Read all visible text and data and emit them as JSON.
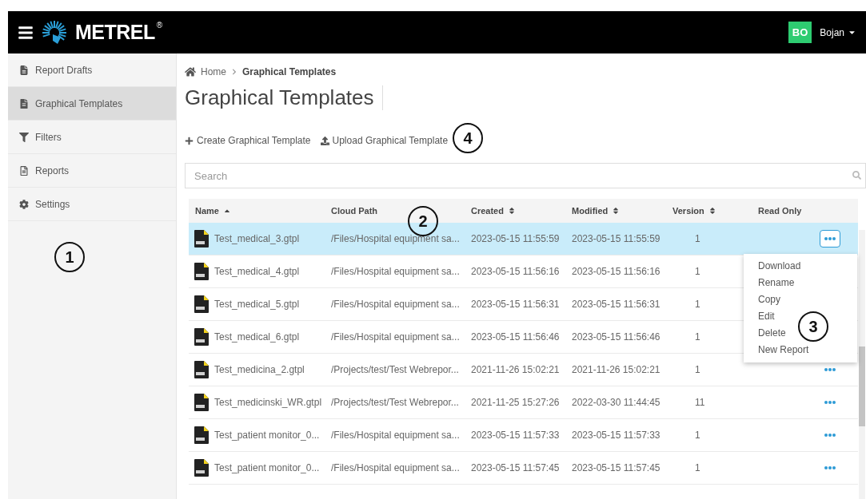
{
  "header": {
    "logo": "METREL",
    "logo_mark": "®",
    "user": {
      "initials": "BO",
      "name": "Bojan"
    }
  },
  "sidebar": {
    "items": [
      {
        "label": "Report Drafts",
        "selected": false
      },
      {
        "label": "Graphical Templates",
        "selected": true
      },
      {
        "label": "Filters",
        "selected": false
      },
      {
        "label": "Reports",
        "selected": false
      },
      {
        "label": "Settings",
        "selected": false
      }
    ]
  },
  "breadcrumb": {
    "home": "Home",
    "current": "Graphical Templates"
  },
  "page_title": "Graphical Templates",
  "actions": [
    {
      "label": "Create Graphical Template"
    },
    {
      "label": "Upload Graphical Template"
    }
  ],
  "search": {
    "placeholder": "Search"
  },
  "table": {
    "columns": [
      {
        "label": "Name",
        "sorted": true,
        "sortable": true
      },
      {
        "label": "Cloud Path",
        "sorted": false,
        "sortable": false
      },
      {
        "label": "Created",
        "sorted": false,
        "sortable": true
      },
      {
        "label": "Modified",
        "sorted": false,
        "sortable": true
      },
      {
        "label": "Version",
        "sorted": false,
        "sortable": true
      },
      {
        "label": "Read Only",
        "sorted": false,
        "sortable": false
      }
    ],
    "rows": [
      {
        "name": "Test_medical_3.gtpl",
        "path": "/Files/Hospital equipment sa...",
        "created": "2023-05-15 11:55:59",
        "modified": "2023-05-15 11:55:59",
        "version": "1",
        "selected": true,
        "actions_shown": true
      },
      {
        "name": "Test_medical_4.gtpl",
        "path": "/Files/Hospital equipment sa...",
        "created": "2023-05-15 11:56:16",
        "modified": "2023-05-15 11:56:16",
        "version": "1",
        "selected": false,
        "actions_shown": false
      },
      {
        "name": "Test_medical_5.gtpl",
        "path": "/Files/Hospital equipment sa...",
        "created": "2023-05-15 11:56:31",
        "modified": "2023-05-15 11:56:31",
        "version": "1",
        "selected": false,
        "actions_shown": false
      },
      {
        "name": "Test_medical_6.gtpl",
        "path": "/Files/Hospital equipment sa...",
        "created": "2023-05-15 11:56:46",
        "modified": "2023-05-15 11:56:46",
        "version": "1",
        "selected": false,
        "actions_shown": false
      },
      {
        "name": "Test_medicina_2.gtpl",
        "path": "/Projects/test/Test Webrepor...",
        "created": "2021-11-26 15:02:21",
        "modified": "2021-11-26 15:02:21",
        "version": "1",
        "selected": false,
        "actions_shown": true
      },
      {
        "name": "Test_medicinski_WR.gtpl",
        "path": "/Projects/test/Test Webrepor...",
        "created": "2021-11-25 15:27:26",
        "modified": "2022-03-30 11:44:45",
        "version": "11",
        "selected": false,
        "actions_shown": true
      },
      {
        "name": "Test_patient monitor_0...",
        "path": "/Files/Hospital equipment sa...",
        "created": "2023-05-15 11:57:33",
        "modified": "2023-05-15 11:57:33",
        "version": "1",
        "selected": false,
        "actions_shown": true
      },
      {
        "name": "Test_patient monitor_0...",
        "path": "/Files/Hospital equipment sa...",
        "created": "2023-05-15 11:57:45",
        "modified": "2023-05-15 11:57:45",
        "version": "1",
        "selected": false,
        "actions_shown": true
      }
    ]
  },
  "context_menu": {
    "open": true,
    "items": [
      "Download",
      "Rename",
      "Copy",
      "Edit",
      "Delete",
      "New Report"
    ]
  },
  "callouts": [
    "1",
    "2",
    "3",
    "4"
  ]
}
